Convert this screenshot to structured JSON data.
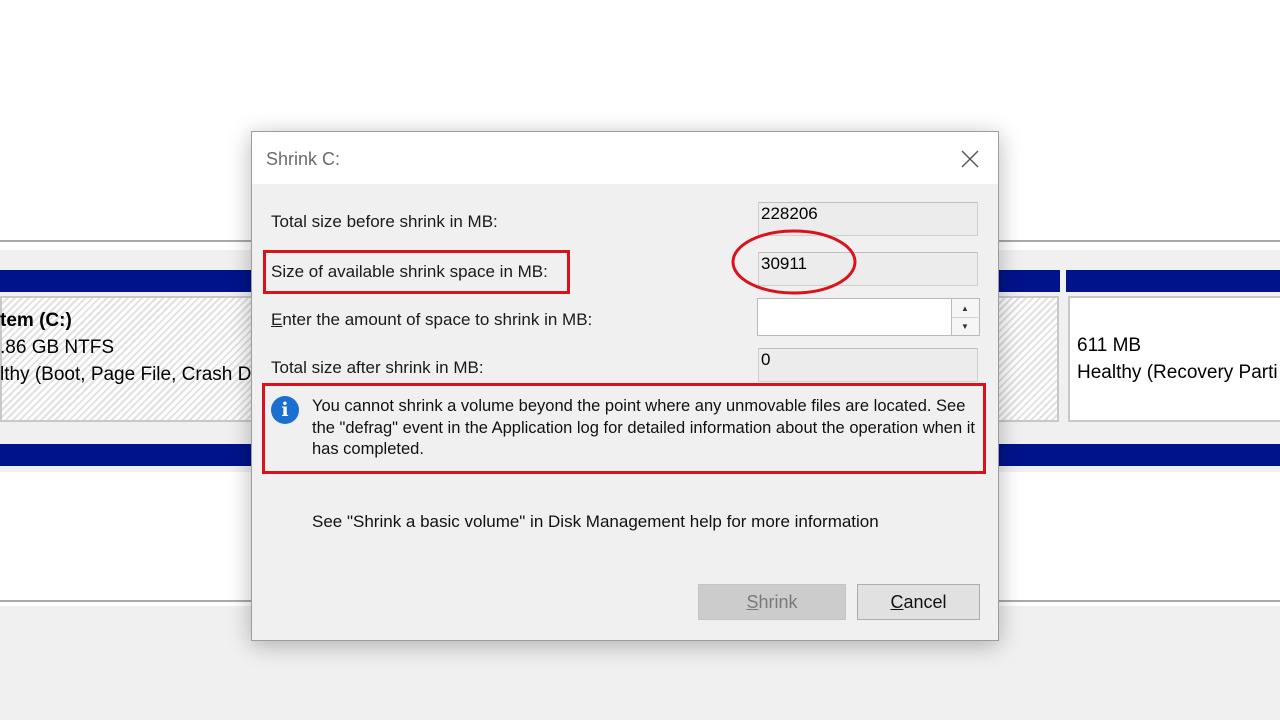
{
  "background": {
    "partition_c": {
      "name": "tem  (C:)",
      "size": ".86 GB NTFS",
      "status": "lthy (Boot, Page File, Crash D"
    },
    "partition_recovery": {
      "size": "611 MB",
      "status": "Healthy (Recovery Parti"
    }
  },
  "dialog": {
    "title": "Shrink C:",
    "close_icon": "close-icon",
    "fields": {
      "total_before": {
        "label": "Total size before shrink in MB:",
        "value": "228206"
      },
      "available": {
        "label": "Size of available shrink space in MB:",
        "value": "30911"
      },
      "enter_amount": {
        "label_prefix": "E",
        "label_rest": "nter the amount of space to shrink in MB:",
        "value": ""
      },
      "total_after": {
        "label": "Total size after shrink in MB:",
        "value": "0"
      }
    },
    "info_icon": "info-icon",
    "info_message": "You cannot shrink a volume beyond the point where any unmovable files are located. See the \"defrag\" event in the Application log for detailed information about the operation when it has completed.",
    "help_text": "See \"Shrink a basic volume\" in Disk Management help for more information",
    "buttons": {
      "shrink": {
        "accel": "S",
        "rest": "hrink",
        "enabled": false
      },
      "cancel": {
        "accel": "C",
        "rest": "ancel"
      }
    }
  },
  "annotations": {
    "color": "#d9121c"
  }
}
